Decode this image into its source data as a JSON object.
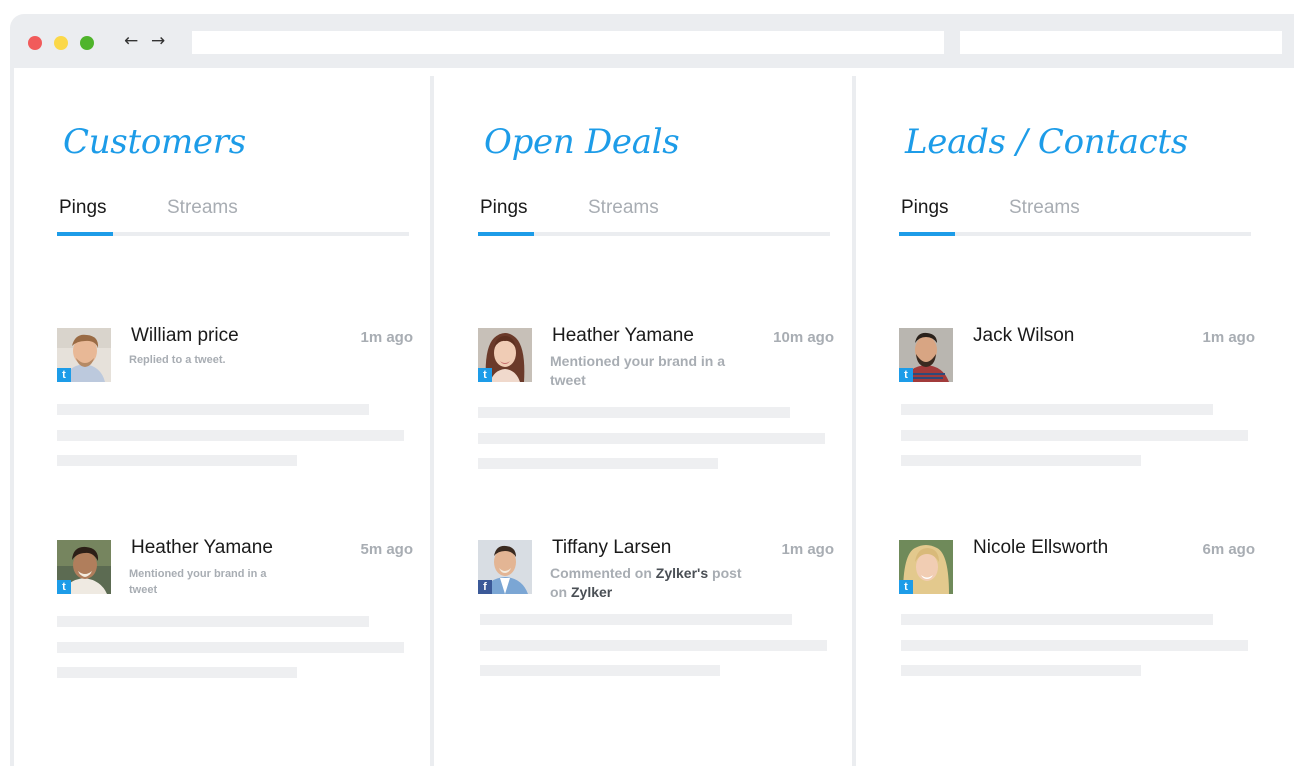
{
  "browser": {
    "nav": {
      "back_glyph": "←",
      "forward_glyph": "→"
    },
    "colors": {
      "close": "#f15b5b",
      "minimize": "#fbd849",
      "maximize": "#4fb42b"
    }
  },
  "accent_color": "#1d9ce8",
  "columns": [
    {
      "title": "Customers",
      "tabs": {
        "active": "Pings",
        "inactive": "Streams"
      },
      "items": [
        {
          "name": "William price",
          "time": "1m ago",
          "source": "twitter",
          "source_glyph": "t",
          "desc_parts": [
            "Replied to a tweet."
          ]
        },
        {
          "name": "Heather Yamane",
          "time": "5m ago",
          "source": "twitter",
          "source_glyph": "t",
          "desc_parts": [
            "Mentioned your brand in a tweet"
          ]
        }
      ]
    },
    {
      "title": "Open Deals",
      "tabs": {
        "active": "Pings",
        "inactive": "Streams"
      },
      "items": [
        {
          "name": "Heather Yamane",
          "time": "10m ago",
          "source": "twitter",
          "source_glyph": "t",
          "desc_parts": [
            "Mentioned your brand in a tweet"
          ]
        },
        {
          "name": "Tiffany Larsen",
          "time": "1m ago",
          "source": "facebook",
          "source_glyph": "f",
          "desc_parts": [
            "Commented on ",
            "Zylker's",
            " post on ",
            "Zylker"
          ]
        }
      ]
    },
    {
      "title": "Leads / Contacts",
      "tabs": {
        "active": "Pings",
        "inactive": "Streams"
      },
      "items": [
        {
          "name": "Jack Wilson",
          "time": "1m ago",
          "source": "twitter",
          "source_glyph": "t",
          "desc_parts": []
        },
        {
          "name": "Nicole Ellsworth",
          "time": "6m ago",
          "source": "twitter",
          "source_glyph": "t",
          "desc_parts": []
        }
      ]
    }
  ]
}
